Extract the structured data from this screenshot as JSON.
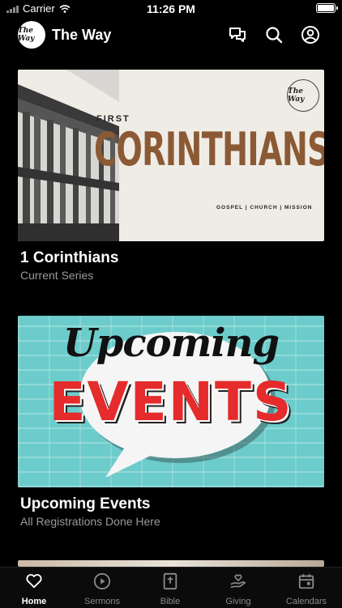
{
  "status_bar": {
    "carrier": "Carrier",
    "time": "11:26 PM",
    "battery_level": 0.92
  },
  "header": {
    "logo_text": "The Way",
    "title": "The Way"
  },
  "icons": {
    "chat": "chat-bubbles-icon",
    "search": "search-icon",
    "account": "account-icon"
  },
  "cards": [
    {
      "title": "1 Corinthians",
      "subtitle": "Current Series",
      "image": {
        "eyebrow": "FIRST",
        "headline": "CORINTHIANS",
        "tagline": "GOSPEL | CHURCH | MISSION",
        "badge_text": "The Way"
      }
    },
    {
      "title": "Upcoming Events",
      "subtitle": "All Registrations Done Here",
      "image": {
        "script_text": "Upcoming",
        "headline": "EVENTS"
      }
    }
  ],
  "tabs": [
    {
      "label": "Home",
      "icon": "heart-icon",
      "active": true
    },
    {
      "label": "Sermons",
      "icon": "play-circle-icon",
      "active": false
    },
    {
      "label": "Bible",
      "icon": "bible-icon",
      "active": false
    },
    {
      "label": "Giving",
      "icon": "giving-hand-icon",
      "active": false
    },
    {
      "label": "Calendars",
      "icon": "calendar-icon",
      "active": false
    }
  ],
  "colors": {
    "background": "#000000",
    "accent_brown": "#8b5a34",
    "events_red": "#e52b2b",
    "events_teal": "#6ccccb",
    "inactive": "#8a8a8a"
  }
}
